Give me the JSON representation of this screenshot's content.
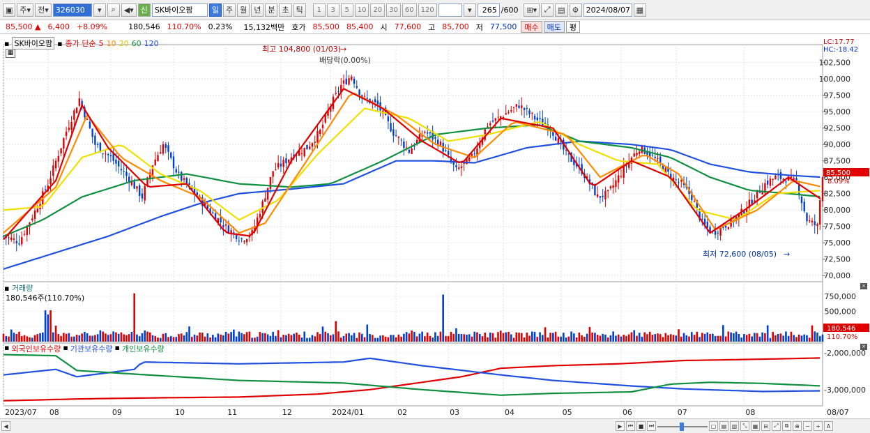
{
  "toolbar": {
    "mode": "주",
    "prev": "전",
    "code": "326030",
    "new_badge": "신",
    "name": "SK바이오팜",
    "periods": [
      "일",
      "주",
      "월",
      "년",
      "분",
      "초",
      "틱"
    ],
    "active_period": "일",
    "counts": [
      "1",
      "3",
      "5",
      "10",
      "20",
      "30",
      "60",
      "120"
    ],
    "range": "265",
    "range_max": "/600",
    "date": "2024/08/07"
  },
  "quote": {
    "price": "85,500",
    "arrow": "▲",
    "change": "6,400",
    "pct": "+8.09%",
    "volume": "180,546",
    "vol_ratio": "110.70%",
    "turnover": "0.23%",
    "amount": "15,132백만",
    "hoga_label": "호가",
    "ask": "85,500",
    "bid": "85,400",
    "open_label": "시",
    "open": "77,600",
    "high_label": "고",
    "high": "85,700",
    "low_label": "저",
    "low": "77,500",
    "buy": "매수",
    "sell": "매도",
    "avg": "평"
  },
  "price_pane": {
    "name": "SK바이오팜",
    "ma_label": "종가 단순",
    "ma_periods": [
      "5",
      "10",
      "20",
      "60",
      "120"
    ],
    "ma_colors": [
      "#e00000",
      "#ff8a00",
      "#f0e000",
      "#109040",
      "#2050e0"
    ],
    "lc": "LC:17.77",
    "hc": "HC:-18.42",
    "high_note": "최고 104,800 (01/03)",
    "low_note": "최저 72,600 (08/05)",
    "dividend": "배당락(0.00%)",
    "price_tag": "85,500",
    "pct_tag": "8.09%"
  },
  "volume_pane": {
    "title": "거래량",
    "value": "180,546주(110.70%)",
    "tag": "180,546",
    "tag_pct": "110.70%"
  },
  "investor_pane": {
    "labels": [
      "외국인보유수량",
      "기관보유수량",
      "개인보유수량"
    ],
    "colors": [
      "#e00000",
      "#2050e0",
      "#109040"
    ]
  },
  "chart_data": {
    "type": "candlestick",
    "y_ticks": [
      "102,500",
      "100,000",
      "97,500",
      "95,000",
      "92,500",
      "90,000",
      "87,500",
      "85,000",
      "82,500",
      "80,000",
      "77,500",
      "75,000",
      "72,500",
      "70,000"
    ],
    "ylim": [
      68750,
      104800
    ],
    "x_ticks": [
      "2023/07",
      "08",
      "09",
      "10",
      "11",
      "12",
      "2024/01",
      "02",
      "03",
      "04",
      "05",
      "06",
      "07",
      "08",
      "08/07"
    ],
    "volume_ticks": [
      "750,000",
      "500,000",
      "250,000"
    ],
    "investor_ticks": [
      "-2,000,000",
      "-3,000,000"
    ],
    "close_path": [
      [
        0,
        76000
      ],
      [
        6,
        75200
      ],
      [
        12,
        79800
      ],
      [
        17,
        84000
      ],
      [
        24,
        92000
      ],
      [
        29,
        97000
      ],
      [
        35,
        90000
      ],
      [
        41,
        88000
      ],
      [
        47,
        85200
      ],
      [
        53,
        82000
      ],
      [
        57,
        87000
      ],
      [
        61,
        90000
      ],
      [
        67,
        85200
      ],
      [
        73,
        82500
      ],
      [
        79,
        79800
      ],
      [
        85,
        77400
      ],
      [
        91,
        75500
      ],
      [
        95,
        76500
      ],
      [
        99,
        81000
      ],
      [
        103,
        86000
      ],
      [
        107,
        87200
      ],
      [
        111,
        88500
      ],
      [
        116,
        89500
      ],
      [
        121,
        92000
      ],
      [
        125,
        96000
      ],
      [
        129,
        99000
      ],
      [
        133,
        100500
      ],
      [
        137,
        97200
      ],
      [
        143,
        96000
      ],
      [
        149,
        91800
      ],
      [
        155,
        89000
      ],
      [
        161,
        92000
      ],
      [
        167,
        90000
      ],
      [
        173,
        86000
      ],
      [
        179,
        88000
      ],
      [
        185,
        93000
      ],
      [
        191,
        94500
      ],
      [
        197,
        96000
      ],
      [
        203,
        94000
      ],
      [
        209,
        92500
      ],
      [
        215,
        88500
      ],
      [
        221,
        86000
      ],
      [
        227,
        82000
      ],
      [
        231,
        82500
      ],
      [
        235,
        85000
      ],
      [
        239,
        87500
      ],
      [
        243,
        89500
      ],
      [
        247,
        88500
      ],
      [
        251,
        87000
      ],
      [
        255,
        85000
      ],
      [
        259,
        84000
      ],
      [
        263,
        82000
      ],
      [
        267,
        78000
      ],
      [
        271,
        76500
      ],
      [
        275,
        77500
      ],
      [
        279,
        78500
      ],
      [
        283,
        80000
      ],
      [
        287,
        82000
      ],
      [
        291,
        84000
      ],
      [
        295,
        85000
      ],
      [
        299,
        84800
      ],
      [
        303,
        84200
      ],
      [
        307,
        78500
      ],
      [
        311,
        77500
      ],
      [
        313,
        85500
      ]
    ],
    "ma_paths": {
      "ma5": [
        [
          0,
          75500
        ],
        [
          20,
          84500
        ],
        [
          30,
          96000
        ],
        [
          40,
          89500
        ],
        [
          55,
          83500
        ],
        [
          70,
          84000
        ],
        [
          85,
          76500
        ],
        [
          95,
          76000
        ],
        [
          110,
          87500
        ],
        [
          130,
          98500
        ],
        [
          145,
          95500
        ],
        [
          160,
          90500
        ],
        [
          175,
          87000
        ],
        [
          190,
          94000
        ],
        [
          210,
          92500
        ],
        [
          225,
          83500
        ],
        [
          240,
          87500
        ],
        [
          255,
          85000
        ],
        [
          270,
          76500
        ],
        [
          285,
          80500
        ],
        [
          300,
          85000
        ],
        [
          313,
          81500
        ]
      ],
      "ma10": [
        [
          0,
          76500
        ],
        [
          20,
          83500
        ],
        [
          32,
          94500
        ],
        [
          45,
          88000
        ],
        [
          60,
          84500
        ],
        [
          75,
          82000
        ],
        [
          90,
          76500
        ],
        [
          100,
          78000
        ],
        [
          115,
          87000
        ],
        [
          133,
          98000
        ],
        [
          150,
          94500
        ],
        [
          165,
          90000
        ],
        [
          180,
          88000
        ],
        [
          195,
          93500
        ],
        [
          215,
          91500
        ],
        [
          228,
          85000
        ],
        [
          245,
          88500
        ],
        [
          258,
          85500
        ],
        [
          272,
          77000
        ],
        [
          288,
          80000
        ],
        [
          302,
          84500
        ],
        [
          313,
          83500
        ]
      ],
      "ma20": [
        [
          0,
          80000
        ],
        [
          15,
          80500
        ],
        [
          30,
          88000
        ],
        [
          45,
          90000
        ],
        [
          60,
          85500
        ],
        [
          75,
          83000
        ],
        [
          90,
          78500
        ],
        [
          105,
          81500
        ],
        [
          120,
          88500
        ],
        [
          138,
          95500
        ],
        [
          155,
          94000
        ],
        [
          170,
          90500
        ],
        [
          185,
          91500
        ],
        [
          205,
          93500
        ],
        [
          220,
          90000
        ],
        [
          235,
          87500
        ],
        [
          250,
          87000
        ],
        [
          265,
          80000
        ],
        [
          280,
          78500
        ],
        [
          295,
          82500
        ],
        [
          313,
          83000
        ]
      ],
      "ma60": [
        [
          0,
          76000
        ],
        [
          15,
          78500
        ],
        [
          30,
          82000
        ],
        [
          50,
          84500
        ],
        [
          70,
          85500
        ],
        [
          90,
          84000
        ],
        [
          110,
          83500
        ],
        [
          125,
          84000
        ],
        [
          145,
          87500
        ],
        [
          165,
          91500
        ],
        [
          185,
          92500
        ],
        [
          205,
          93000
        ],
        [
          220,
          90500
        ],
        [
          240,
          89500
        ],
        [
          255,
          88000
        ],
        [
          270,
          85000
        ],
        [
          285,
          83000
        ],
        [
          300,
          82500
        ],
        [
          313,
          82000
        ]
      ],
      "ma120": [
        [
          0,
          71000
        ],
        [
          20,
          73500
        ],
        [
          40,
          76000
        ],
        [
          60,
          79000
        ],
        [
          75,
          81000
        ],
        [
          90,
          82500
        ],
        [
          110,
          83200
        ],
        [
          130,
          84000
        ],
        [
          150,
          87500
        ],
        [
          165,
          87500
        ],
        [
          180,
          87200
        ],
        [
          200,
          89500
        ],
        [
          220,
          90500
        ],
        [
          240,
          90000
        ],
        [
          255,
          89200
        ],
        [
          270,
          87000
        ],
        [
          285,
          85800
        ],
        [
          300,
          85300
        ],
        [
          313,
          85000
        ]
      ]
    },
    "investor_paths": {
      "foreign": [
        [
          0,
          -3300000
        ],
        [
          30,
          -3250000
        ],
        [
          60,
          -3220000
        ],
        [
          90,
          -3200000
        ],
        [
          120,
          -3120000
        ],
        [
          140,
          -3000000
        ],
        [
          155,
          -2850000
        ],
        [
          175,
          -2650000
        ],
        [
          190,
          -2420000
        ],
        [
          210,
          -2350000
        ],
        [
          235,
          -2300000
        ],
        [
          260,
          -2210000
        ],
        [
          285,
          -2180000
        ],
        [
          313,
          -2140000
        ]
      ],
      "institution": [
        [
          0,
          -2600000
        ],
        [
          20,
          -2450000
        ],
        [
          28,
          -2650000
        ],
        [
          50,
          -2450000
        ],
        [
          53,
          -2250000
        ],
        [
          90,
          -2300000
        ],
        [
          130,
          -2250000
        ],
        [
          140,
          -2150000
        ],
        [
          160,
          -2350000
        ],
        [
          190,
          -2600000
        ],
        [
          210,
          -2750000
        ],
        [
          240,
          -2900000
        ],
        [
          260,
          -2980000
        ],
        [
          290,
          -3050000
        ],
        [
          313,
          -3030000
        ]
      ],
      "individual": [
        [
          0,
          -2050000
        ],
        [
          20,
          -2080000
        ],
        [
          28,
          -2480000
        ],
        [
          55,
          -2600000
        ],
        [
          90,
          -2750000
        ],
        [
          130,
          -2820000
        ],
        [
          160,
          -3000000
        ],
        [
          190,
          -3150000
        ],
        [
          210,
          -3100000
        ],
        [
          240,
          -3060000
        ],
        [
          255,
          -2850000
        ],
        [
          270,
          -2800000
        ],
        [
          290,
          -2830000
        ],
        [
          313,
          -2900000
        ]
      ]
    }
  }
}
